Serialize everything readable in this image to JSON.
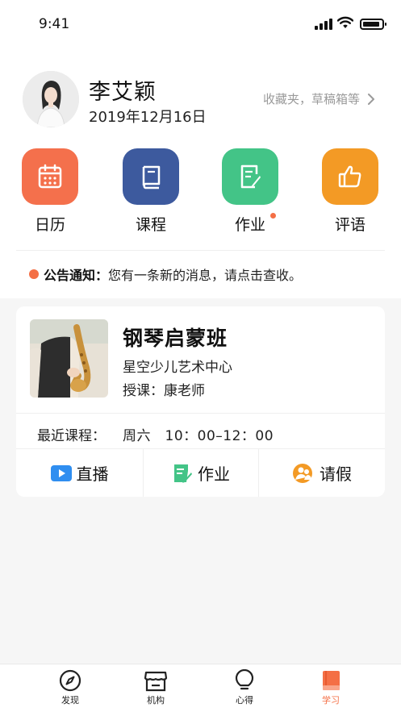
{
  "status_bar": {
    "time": "9:41"
  },
  "profile": {
    "name": "李艾颖",
    "date": "2019年12月16日",
    "more_link": "收藏夹，草稿箱等"
  },
  "quick_actions": [
    {
      "label": "日历",
      "icon": "calendar-icon",
      "color": "#f4704c",
      "badge": false
    },
    {
      "label": "课程",
      "icon": "book-icon",
      "color": "#3d5a9e",
      "badge": false
    },
    {
      "label": "作业",
      "icon": "homework-icon",
      "color": "#43c487",
      "badge": true
    },
    {
      "label": "评语",
      "icon": "thumbs-up-icon",
      "color": "#f39a25",
      "badge": false
    }
  ],
  "notice": {
    "title": "公告通知：",
    "text": "您有一条新的消息，请点击查收。"
  },
  "course": {
    "title": "钢琴启蒙班",
    "org": "星空少儿艺术中心",
    "teacher": "授课：康老师",
    "recent_label": "最近课程：",
    "recent_value": "周六　10：00–12：00",
    "actions": [
      {
        "label": "直播",
        "icon": "play-icon"
      },
      {
        "label": "作业",
        "icon": "homework-edit-icon"
      },
      {
        "label": "请假",
        "icon": "leave-icon"
      }
    ]
  },
  "tabs": [
    {
      "label": "发现",
      "icon": "compass-icon",
      "active": false
    },
    {
      "label": "机构",
      "icon": "store-icon",
      "active": false
    },
    {
      "label": "心得",
      "icon": "bulb-icon",
      "active": false
    },
    {
      "label": "学习",
      "icon": "study-book-icon",
      "active": true
    }
  ],
  "colors": {
    "accent": "#f46f45",
    "background": "#f6f6f6"
  }
}
